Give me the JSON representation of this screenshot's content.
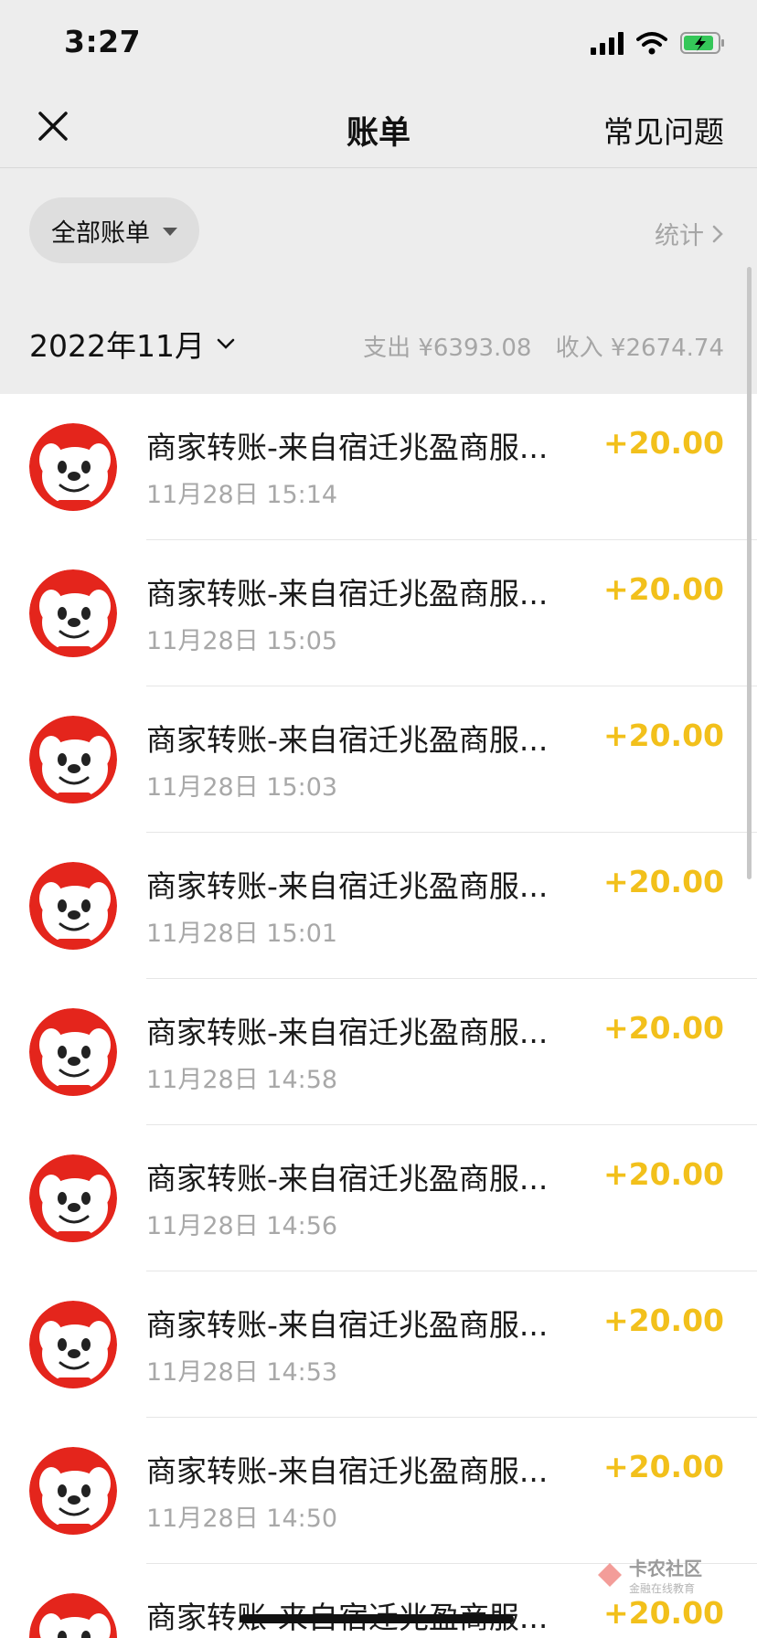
{
  "status_bar": {
    "time": "3:27"
  },
  "nav": {
    "title": "账单",
    "faq": "常见问题"
  },
  "filter": {
    "chip_label": "全部账单",
    "stats_label": "统计"
  },
  "month": {
    "label": "2022年11月",
    "summary_expense": "支出 ¥6393.08",
    "summary_income": "收入 ¥2674.74"
  },
  "transactions": [
    {
      "title": "商家转账-来自宿迁兆盈商服...",
      "time": "11月28日 15:14",
      "amount": "+20.00"
    },
    {
      "title": "商家转账-来自宿迁兆盈商服...",
      "time": "11月28日 15:05",
      "amount": "+20.00"
    },
    {
      "title": "商家转账-来自宿迁兆盈商服...",
      "time": "11月28日 15:03",
      "amount": "+20.00"
    },
    {
      "title": "商家转账-来自宿迁兆盈商服...",
      "time": "11月28日 15:01",
      "amount": "+20.00"
    },
    {
      "title": "商家转账-来自宿迁兆盈商服...",
      "time": "11月28日 14:58",
      "amount": "+20.00"
    },
    {
      "title": "商家转账-来自宿迁兆盈商服...",
      "time": "11月28日 14:56",
      "amount": "+20.00"
    },
    {
      "title": "商家转账-来自宿迁兆盈商服...",
      "time": "11月28日 14:53",
      "amount": "+20.00"
    },
    {
      "title": "商家转账-来自宿迁兆盈商服...",
      "time": "11月28日 14:50",
      "amount": "+20.00"
    },
    {
      "title": "商家转账-来自宿迁兆盈商服...",
      "time": "",
      "amount": "+20.00"
    }
  ],
  "watermark": {
    "title": "卡农社区",
    "subtitle": "金融在线教育"
  },
  "colors": {
    "amount": "#f2c01b",
    "header_bg": "#ededed",
    "avatar_red": "#e4251c"
  },
  "icons": {
    "close": "close-icon",
    "caret": "caret-down-icon",
    "chevron": "chevron-right-icon",
    "avatar": "jd-mascot-icon"
  }
}
